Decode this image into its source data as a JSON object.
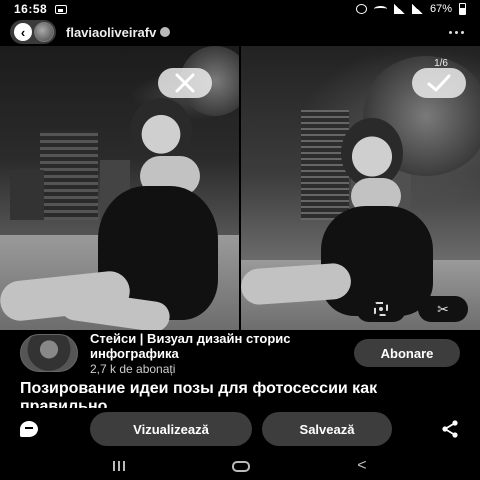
{
  "status_bar": {
    "time": "16:58",
    "battery": "67%"
  },
  "header": {
    "username": "flaviaoliveirafv"
  },
  "photos": {
    "page_counter": "1/6"
  },
  "creator": {
    "name": "Стейси | Визуал дизайн сторис инфографика",
    "followers": "2,7 k de abonați",
    "follow_label": "Abonare"
  },
  "pin": {
    "title": "Позирование идеи позы для фотосессии как правильно"
  },
  "actions": {
    "visit_label": "Vizualizează",
    "save_label": "Salvează"
  },
  "icons": {
    "back": "chevron-left-icon",
    "more": "more-icon",
    "reject": "close-icon",
    "accept": "check-icon",
    "lens": "visual-search-icon",
    "cut": "scissors-icon",
    "comment": "comment-icon",
    "share": "share-icon"
  }
}
